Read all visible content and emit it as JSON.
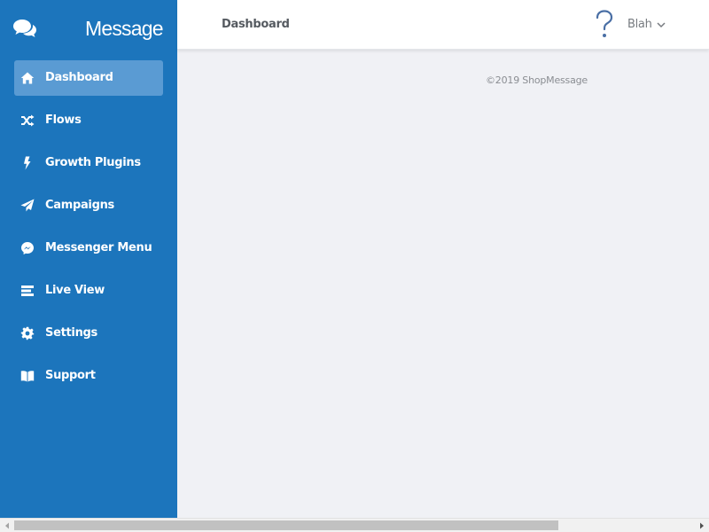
{
  "brand": {
    "name": "Message",
    "icon": "chat-bubbles-icon"
  },
  "sidebar": {
    "items": [
      {
        "label": "Dashboard",
        "icon": "home-icon",
        "active": true
      },
      {
        "label": "Flows",
        "icon": "shuffle-icon",
        "active": false
      },
      {
        "label": "Growth Plugins",
        "icon": "bolt-icon",
        "active": false
      },
      {
        "label": "Campaigns",
        "icon": "paper-plane-icon",
        "active": false
      },
      {
        "label": "Messenger Menu",
        "icon": "messenger-icon",
        "active": false
      },
      {
        "label": "Live View",
        "icon": "list-icon",
        "active": false
      },
      {
        "label": "Settings",
        "icon": "gear-icon",
        "active": false
      },
      {
        "label": "Support",
        "icon": "book-icon",
        "active": false
      }
    ]
  },
  "header": {
    "title": "Dashboard",
    "help_icon": "question-mark-icon",
    "user_name": "Blah"
  },
  "footer": {
    "copyright": "©2019 ShopMessage"
  },
  "colors": {
    "sidebar_bg": "#1c75bc",
    "active_item_bg": "#5a9bd3",
    "content_bg": "#f0f1f5",
    "help_icon": "#4a6fa5"
  }
}
